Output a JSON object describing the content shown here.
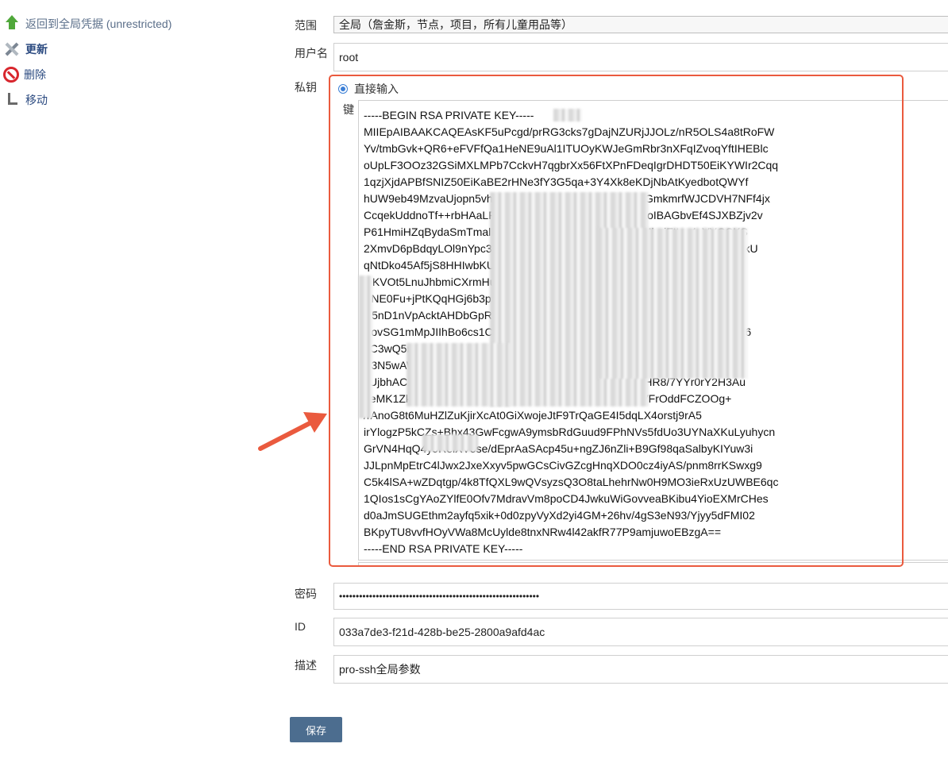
{
  "sidebar": {
    "items": [
      {
        "label": "返回到全局凭据 (unrestricted)",
        "icon": "arrow-up-icon"
      },
      {
        "label": "更新",
        "icon": "tools-icon"
      },
      {
        "label": "删除",
        "icon": "delete-icon"
      },
      {
        "label": "移动",
        "icon": "move-icon"
      }
    ]
  },
  "form": {
    "scope_label": "范围",
    "scope_value": "全局（詹金斯，节点，项目，所有儿童用品等）",
    "username_label": "用户名",
    "username_value": "root",
    "private_key_label": "私钥",
    "direct_input_label": "直接输入",
    "key_label": "键",
    "key_text": "-----BEGIN RSA PRIVATE KEY-----\nMIIEpAIBAAKCAQEAsKF5uPcgd/prRG3cks7gDajNZURjJJOLz/nR5OLS4a8tRoFW\nYv/tmbGvk+QR6+eFVFfQa1HeNE9uAl1ITUOyKWJeGmRbr3nXFqIZvoqYftIHEBlc\noUpLF3OOz32GSiMXLMPb7CckvH7qgbrXx56FtXPnFDeqIgrDHDT50EiKYWIr2Cqq\n1qzjXjdAPBfSNIZ50EiKaBE2rHNe3fY3G5qa+3Y4Xk8eKDjNbAtKyedbotQWYf\nhUW9eb49MzvaUjopn5vhvsQiz+YohWhuvcKA8qgRBnr7GmkmrfWJCDVH7NFf4jx\nCcqekUddnoTf++rbHAaLF+70IxTvJZJVRDxCDIDRQ+BAoIBAGbvEf4SJXBZjv2v\nP61HmiHZqBydaSmTmalMUqystGhzwsK8mRFtfxtqjLrjeMbaiFttxv4yVYGSKS\n2XmvD6pBdqyLOl9nYpc3BMvm3rj+nLn6ux8KsnS3Cqgx8ngUxxJHlGoK2635kU\nqNtDko45Af5jS8HHIwbKUjibhSatNAYgjKdtvoCjLHFrvjmSo9It+f\nQKVOt5LnuJhbmiCXrmHu8DHeBwxwjVmsoBeakEfwWZfXbY6ykCwdlHr28\nSNE0Fu+jPtKQqHGj6b3p5utHhMk7XzhgcfrKcnSdhO+gEl4lBmAyi\nU5nD1nVpAcktAHDbGpRw8K1dCvd2o9nHcGbA+hOqImKgduhlCNHPM/t\nBovSG1mMpJIIhBo6cs1Cx+HRj9k1sKznpGMdneHGxSmZFKW8DknaKFxjv06\n9C3wQ5mBMPvLSJbS+PrKoLR6WaB1mK8bjAlNMK8/0pFduXAoGBAMqZ\nE3N5wAWWLzHeaHE/ilgOud4xkqxmqZfCRojdXCFmRTUD5LNg01dlJqA+sV\nsUjbhACNRBYpBuKCYHke1G+WlqqhKVDM/Ha73UNEnHR8/7YYr0rY2H3Au\nueMK1ZkG6tuw3LWaIKVHoWZIlhkmFBBDK7BAK7vbUlVFrOddFCZOOg+\n/rAnoG8t6MuHZlZuKjirXcAt0GiXwojeJtF9TrQaGE4I5dqLX4orstj9rA5\nirYlogzP5kCZs+Bhx43GwFcgwA9ymsbRdGuud9FPhNVs5fdUo3UYNaXKuLyuhycn\nGrVN4HqQ4y9RelXV5se/dEprAaSAcp45u+ngZJ6nZli+B9Gf98qaSalbyKIYuw3i\nJJLpnMpEtrC4lJwx2JxeXxyv5pwGCsCivGZcgHnqXDO0cz4iyAS/pnm8rrKSwxg9\nC5k4lSA+wZDqtgp/4k8TfQXL9wQVsyzsQ3O8taLhehrNw0H9MO3ieRxUzUWBE6qc\n1QIos1sCgYAoZYlfE0Ofv7MdravVm8poCD4JwkuWiGovveaBKibu4YioEXMrCHes\nd0aJmSUGEthm2ayfq5xik+0d0zpyVyXd2yi4GM+26hv/4gS3eN93/Yjyy5dFMI02\nBKpyTU8vvfHOyVWa8McUylde8tnxNRw4l42akfR77P9amjuwoEBzgA==\n-----END RSA PRIVATE KEY-----",
    "password_label": "密码",
    "password_value": "••••••••••••••••••••••••••••••••••••••••••••••••••••••••••••",
    "id_label": "ID",
    "id_value": "033a7de3-f21d-428b-be25-2800a9afd4ac",
    "description_label": "描述",
    "description_value": "pro-ssh全局参数",
    "save_label": "保存"
  },
  "colors": {
    "highlight": "#ea5a3e",
    "button": "#4c6d8f",
    "link": "#2b4a80"
  }
}
